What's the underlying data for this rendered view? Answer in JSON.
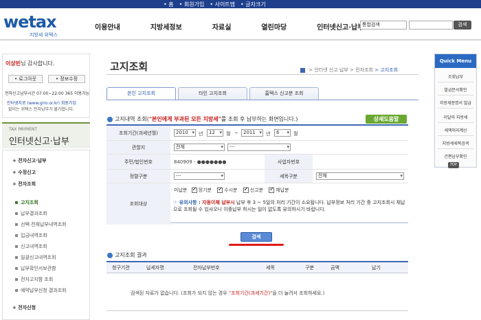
{
  "top_links": [
    "• 홈",
    "• 회원가입",
    "• 사이트맵",
    "• 글자크기"
  ],
  "logo": {
    "main": "wetax",
    "sub": "지방세 위택스"
  },
  "gnb": [
    "이용안내",
    "지방세정보",
    "자료실",
    "열린마당",
    "인터넷신고·납부"
  ],
  "search": {
    "scope": "통합검색",
    "button": "검색"
  },
  "login": {
    "user": "이상빈",
    "welcome_suffix": "님 감사합니다.",
    "logout": "• 로그아웃",
    "info": "• 정보수정",
    "hours": "전자신고납부시간 07:00~22:00 365 이용가능",
    "giro": "인터넷지로 (www.giro.or.kr) 회원가입",
    "giro_note": "없이는 위택스 전자납부가 불가합니다."
  },
  "side": {
    "en": "TAX PAYMENT",
    "title": "인터넷신고·납부",
    "items": [
      "+ 전자신고·납부",
      "+ 수정신고",
      "+ 전자조회"
    ],
    "subs": [
      "고지조회",
      "납부결과조회",
      "선택·전체납부내역조회",
      "입금내역조회",
      "신고내역조회",
      "일괄신고내역조회",
      "납부확인서보관함",
      "전자고지함 조회",
      "예약납부신청 결과조회"
    ],
    "last": "+ 전자신청"
  },
  "page": {
    "title": "고지조회",
    "breadcrumb": [
      "> 인터넷 신고 납부",
      "> 전자조회",
      "> 고지조회"
    ]
  },
  "tabs": [
    "본인 고지조회",
    "타인 고지조회",
    "홈택스 신고분 조회"
  ],
  "section1": {
    "prefix": "고지내역 조회(",
    "highlight": "\"본인에게 부과된 모든 지방세\"",
    "suffix": "를 조회 후 납부하는 화면입니다.)"
  },
  "btn_help": "상세도움말",
  "form": {
    "period_label": "조회기간(과세년월)",
    "from_year": "2010",
    "from_month": "12",
    "to_year": "2011",
    "to_month": "6",
    "unit_year": "년",
    "unit_month": "월",
    "tilde": "~",
    "region_label": "관할지",
    "region1": "전체",
    "region2": "---",
    "id_label": "주민/법인번호",
    "id_value": "840909 - ●●●●●●●",
    "biz_label": "사업자번호",
    "reg_label": "정렬구분",
    "reg_value": "---",
    "tax_label": "세목구분",
    "tax_value": "전체",
    "target_label": "조회대상",
    "check_labels": [
      "미납분",
      "정기분",
      "수시분",
      "신고분",
      "체납분"
    ],
    "notice_prefix": "☞ 유의사항 : ",
    "notice_red": "자동이체 납부시",
    "notice_text": " 납부 후 3 ~ 5일의 처리 기간이 소요됩니다. 납부정보 처리 기간 중 고지조회시 체납으로 조회될 수 있사오니 이중납부 하시는 일이 없도록 유의하시기 바랍니다."
  },
  "btn_submit": "검색",
  "section2": {
    "title": "고지조회 결과"
  },
  "result_cols": [
    "청구기관",
    "납세자명",
    "전자납부번호",
    "세목",
    "구분",
    "금액",
    "납기"
  ],
  "empty": {
    "prefix": "검색된 자료가 없습니다. (조회가 되지 않는 경우 ",
    "red": "\"조회기간(과세기간)\"",
    "suffix": "을 더 늘려서 조회하세요.)"
  },
  "quick": {
    "head": "Quick Menu",
    "items": [
      "조회납부",
      "발급문서확인",
      "지방세증명서 발급",
      "이달의 지방세",
      "세액미리계산",
      "지방세세목검색",
      "간편납부확인"
    ],
    "top": "TOP"
  },
  "colors": {
    "navy": "#1d3f8c",
    "blue": "#3d66b4",
    "green": "#6aa832",
    "red": "#c21b17"
  }
}
